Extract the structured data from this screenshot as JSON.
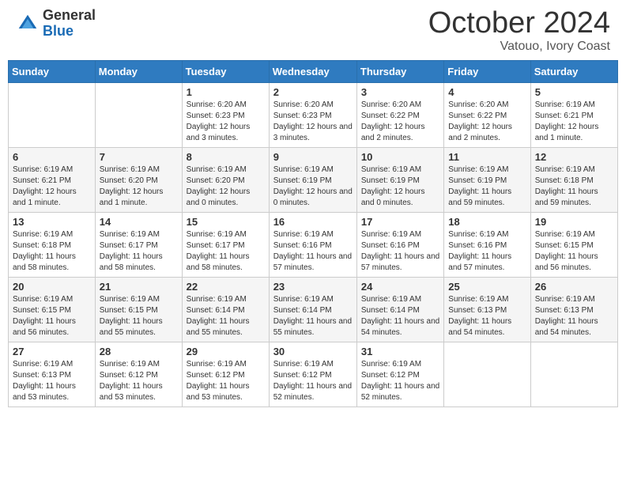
{
  "logo": {
    "general": "General",
    "blue": "Blue"
  },
  "header": {
    "month": "October 2024",
    "location": "Vatouo, Ivory Coast"
  },
  "weekdays": [
    "Sunday",
    "Monday",
    "Tuesday",
    "Wednesday",
    "Thursday",
    "Friday",
    "Saturday"
  ],
  "weeks": [
    [
      {
        "day": "",
        "info": ""
      },
      {
        "day": "",
        "info": ""
      },
      {
        "day": "1",
        "info": "Sunrise: 6:20 AM\nSunset: 6:23 PM\nDaylight: 12 hours and 3 minutes."
      },
      {
        "day": "2",
        "info": "Sunrise: 6:20 AM\nSunset: 6:23 PM\nDaylight: 12 hours and 3 minutes."
      },
      {
        "day": "3",
        "info": "Sunrise: 6:20 AM\nSunset: 6:22 PM\nDaylight: 12 hours and 2 minutes."
      },
      {
        "day": "4",
        "info": "Sunrise: 6:20 AM\nSunset: 6:22 PM\nDaylight: 12 hours and 2 minutes."
      },
      {
        "day": "5",
        "info": "Sunrise: 6:19 AM\nSunset: 6:21 PM\nDaylight: 12 hours and 1 minute."
      }
    ],
    [
      {
        "day": "6",
        "info": "Sunrise: 6:19 AM\nSunset: 6:21 PM\nDaylight: 12 hours and 1 minute."
      },
      {
        "day": "7",
        "info": "Sunrise: 6:19 AM\nSunset: 6:20 PM\nDaylight: 12 hours and 1 minute."
      },
      {
        "day": "8",
        "info": "Sunrise: 6:19 AM\nSunset: 6:20 PM\nDaylight: 12 hours and 0 minutes."
      },
      {
        "day": "9",
        "info": "Sunrise: 6:19 AM\nSunset: 6:19 PM\nDaylight: 12 hours and 0 minutes."
      },
      {
        "day": "10",
        "info": "Sunrise: 6:19 AM\nSunset: 6:19 PM\nDaylight: 12 hours and 0 minutes."
      },
      {
        "day": "11",
        "info": "Sunrise: 6:19 AM\nSunset: 6:19 PM\nDaylight: 11 hours and 59 minutes."
      },
      {
        "day": "12",
        "info": "Sunrise: 6:19 AM\nSunset: 6:18 PM\nDaylight: 11 hours and 59 minutes."
      }
    ],
    [
      {
        "day": "13",
        "info": "Sunrise: 6:19 AM\nSunset: 6:18 PM\nDaylight: 11 hours and 58 minutes."
      },
      {
        "day": "14",
        "info": "Sunrise: 6:19 AM\nSunset: 6:17 PM\nDaylight: 11 hours and 58 minutes."
      },
      {
        "day": "15",
        "info": "Sunrise: 6:19 AM\nSunset: 6:17 PM\nDaylight: 11 hours and 58 minutes."
      },
      {
        "day": "16",
        "info": "Sunrise: 6:19 AM\nSunset: 6:16 PM\nDaylight: 11 hours and 57 minutes."
      },
      {
        "day": "17",
        "info": "Sunrise: 6:19 AM\nSunset: 6:16 PM\nDaylight: 11 hours and 57 minutes."
      },
      {
        "day": "18",
        "info": "Sunrise: 6:19 AM\nSunset: 6:16 PM\nDaylight: 11 hours and 57 minutes."
      },
      {
        "day": "19",
        "info": "Sunrise: 6:19 AM\nSunset: 6:15 PM\nDaylight: 11 hours and 56 minutes."
      }
    ],
    [
      {
        "day": "20",
        "info": "Sunrise: 6:19 AM\nSunset: 6:15 PM\nDaylight: 11 hours and 56 minutes."
      },
      {
        "day": "21",
        "info": "Sunrise: 6:19 AM\nSunset: 6:15 PM\nDaylight: 11 hours and 55 minutes."
      },
      {
        "day": "22",
        "info": "Sunrise: 6:19 AM\nSunset: 6:14 PM\nDaylight: 11 hours and 55 minutes."
      },
      {
        "day": "23",
        "info": "Sunrise: 6:19 AM\nSunset: 6:14 PM\nDaylight: 11 hours and 55 minutes."
      },
      {
        "day": "24",
        "info": "Sunrise: 6:19 AM\nSunset: 6:14 PM\nDaylight: 11 hours and 54 minutes."
      },
      {
        "day": "25",
        "info": "Sunrise: 6:19 AM\nSunset: 6:13 PM\nDaylight: 11 hours and 54 minutes."
      },
      {
        "day": "26",
        "info": "Sunrise: 6:19 AM\nSunset: 6:13 PM\nDaylight: 11 hours and 54 minutes."
      }
    ],
    [
      {
        "day": "27",
        "info": "Sunrise: 6:19 AM\nSunset: 6:13 PM\nDaylight: 11 hours and 53 minutes."
      },
      {
        "day": "28",
        "info": "Sunrise: 6:19 AM\nSunset: 6:12 PM\nDaylight: 11 hours and 53 minutes."
      },
      {
        "day": "29",
        "info": "Sunrise: 6:19 AM\nSunset: 6:12 PM\nDaylight: 11 hours and 53 minutes."
      },
      {
        "day": "30",
        "info": "Sunrise: 6:19 AM\nSunset: 6:12 PM\nDaylight: 11 hours and 52 minutes."
      },
      {
        "day": "31",
        "info": "Sunrise: 6:19 AM\nSunset: 6:12 PM\nDaylight: 11 hours and 52 minutes."
      },
      {
        "day": "",
        "info": ""
      },
      {
        "day": "",
        "info": ""
      }
    ]
  ]
}
